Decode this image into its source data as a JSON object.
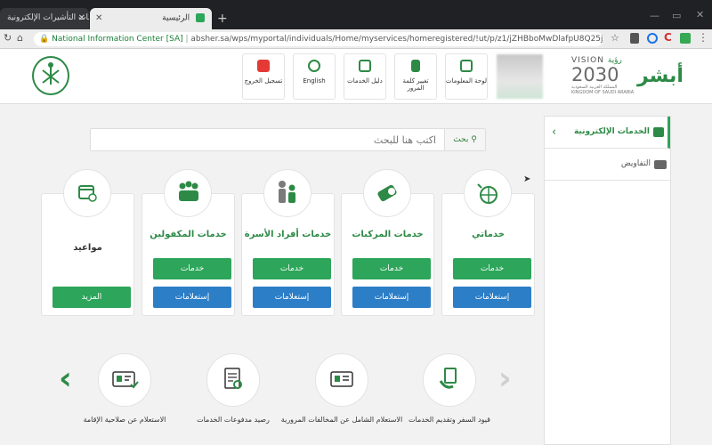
{
  "browser": {
    "tab_inactive": "منصة خدمات التأشيرات الإلكترونية",
    "tab_active": "الرئيسية",
    "new_tab": "+",
    "secure_label": "National Information Center [SA]",
    "url": "absher.sa/wps/myportal/individuals/Home/myservices/homeregistered/!ut/p/z1/jZHBboMwDlafpU8Q25jANQzqAp0yQKU0lI4pTRdV20zT..."
  },
  "header": {
    "buttons": [
      {
        "label": "لوحة المعلومات"
      },
      {
        "label": "تغيير كلمة المرور"
      },
      {
        "label": "دليل الخدمات"
      },
      {
        "label": "English"
      },
      {
        "label": "تسجيل الخروج"
      }
    ],
    "vision_text": "VISION",
    "vision_arabic": "رؤية",
    "vision_year": "2030",
    "vision_sub": "المملكة العربية السعودية",
    "vision_sub_en": "KINGDOM OF SAUDI ARABIA",
    "absher_logo": "أبشر"
  },
  "sidebar": {
    "active_item": "الخدمات الإلكترونية",
    "item2": "التفاويض"
  },
  "search": {
    "placeholder": "اكتب هنا للبحث",
    "button": "بحث"
  },
  "cards": [
    {
      "title": "خدماتي",
      "btn1": "خدمات",
      "btn2": "إستعلامات"
    },
    {
      "title": "خدمات المركبات",
      "btn1": "خدمات",
      "btn2": "إستعلامات"
    },
    {
      "title": "خدمات أفراد الأسرة",
      "btn1": "خدمات",
      "btn2": "إستعلامات"
    },
    {
      "title": "خدمات المكفولين",
      "btn1": "خدمات",
      "btn2": "إستعلامات"
    },
    {
      "title": "مواعيد",
      "btn1": "المزيد"
    }
  ],
  "carousel": [
    {
      "label": "قيود السفر وتقديم الخدمات"
    },
    {
      "label": "الاستعلام الشامل عن المخالفات المرورية"
    },
    {
      "label": "رصيد مدفوعات الخدمات"
    },
    {
      "label": "الاستعلام عن صلاحية الإقامة"
    }
  ],
  "colors": {
    "green": "#2da55a",
    "blue": "#2c7ec7",
    "dark_green": "#2d8a46"
  }
}
